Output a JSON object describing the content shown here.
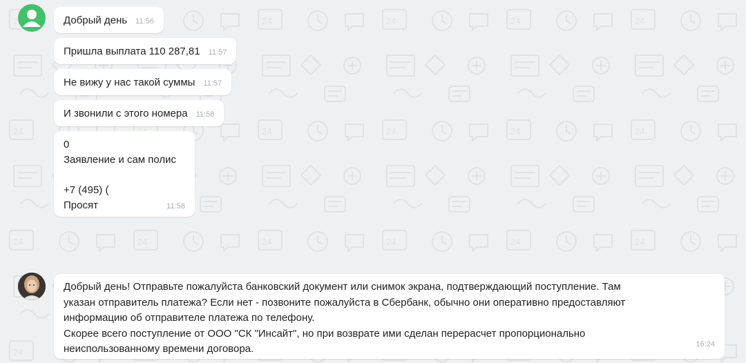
{
  "chat": {
    "messages": [
      {
        "text": "Добрый день",
        "time": "11:56"
      },
      {
        "text": "Пришла выплата 110 287,81",
        "time": "11:57"
      },
      {
        "text": "Не вижу у нас такой суммы",
        "time": "11:57"
      },
      {
        "text": "И звонили с этого номера",
        "time": "11:58"
      },
      {
        "line1": "0",
        "line2": "Заявление и сам полис",
        "line3": "+7 (495) (",
        "line4": "Просят",
        "time": "11:58"
      }
    ],
    "reply": {
      "lines": [
        "Добрый день! Отправьте пожалуйста банковский документ или снимок экрана, подтверждающий поступление. Там",
        "указан отправитель платежа? Если нет - позвоните пожалуйста в Сбербанк, обычно они оперативно предоставляют",
        "информацию об отправителе платежа по телефону.",
        "Скорее всего поступление от ООО \"СК \"Инсайт\", но при возврате ими сделан перерасчет пропорционально",
        "неиспользованному времени договора."
      ],
      "time": "16:24"
    }
  },
  "icons": {
    "user_avatar": "user-silhouette-icon",
    "agent_avatar": "agent-photo-avatar"
  },
  "colors": {
    "background": "#eef0f2",
    "bubble": "#ffffff",
    "user_avatar": "#43c06a",
    "time": "#a8adb3"
  }
}
